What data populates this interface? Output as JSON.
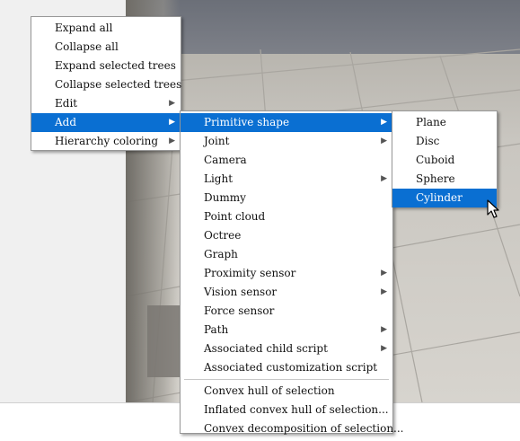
{
  "main_menu": {
    "items": [
      {
        "label": "Expand all",
        "has_submenu": false
      },
      {
        "label": "Collapse all",
        "has_submenu": false
      },
      {
        "label": "Expand selected trees",
        "has_submenu": false
      },
      {
        "label": "Collapse selected trees",
        "has_submenu": false
      },
      {
        "label": "Edit",
        "has_submenu": true
      },
      {
        "label": "Add",
        "has_submenu": true,
        "highlighted": true
      },
      {
        "label": "Hierarchy coloring",
        "has_submenu": true
      }
    ]
  },
  "add_menu": {
    "items": [
      {
        "label": "Primitive shape",
        "has_submenu": true,
        "highlighted": true
      },
      {
        "label": "Joint",
        "has_submenu": true
      },
      {
        "label": "Camera",
        "has_submenu": false
      },
      {
        "label": "Light",
        "has_submenu": true
      },
      {
        "label": "Dummy",
        "has_submenu": false
      },
      {
        "label": "Point cloud",
        "has_submenu": false
      },
      {
        "label": "Octree",
        "has_submenu": false
      },
      {
        "label": "Graph",
        "has_submenu": false
      },
      {
        "label": "Proximity sensor",
        "has_submenu": true
      },
      {
        "label": "Vision sensor",
        "has_submenu": true
      },
      {
        "label": "Force sensor",
        "has_submenu": false
      },
      {
        "label": "Path",
        "has_submenu": true
      },
      {
        "label": "Associated child script",
        "has_submenu": true
      },
      {
        "label": "Associated customization script",
        "has_submenu": false
      }
    ],
    "items_after_separator": [
      {
        "label": "Convex hull of selection",
        "has_submenu": false
      },
      {
        "label": "Inflated convex hull of selection...",
        "has_submenu": false
      },
      {
        "label": "Convex decomposition of selection...",
        "has_submenu": false
      }
    ]
  },
  "primitive_menu": {
    "items": [
      {
        "label": "Plane"
      },
      {
        "label": "Disc"
      },
      {
        "label": "Cuboid"
      },
      {
        "label": "Sphere"
      },
      {
        "label": "Cylinder",
        "highlighted": true
      }
    ]
  },
  "icons": {
    "submenu_arrow": "chevron-right-icon",
    "cursor": "mouse-pointer-icon"
  },
  "colors": {
    "highlight": "#0a6fd2",
    "menu_bg": "#ffffff",
    "panel_bg": "#f0f0f0"
  }
}
